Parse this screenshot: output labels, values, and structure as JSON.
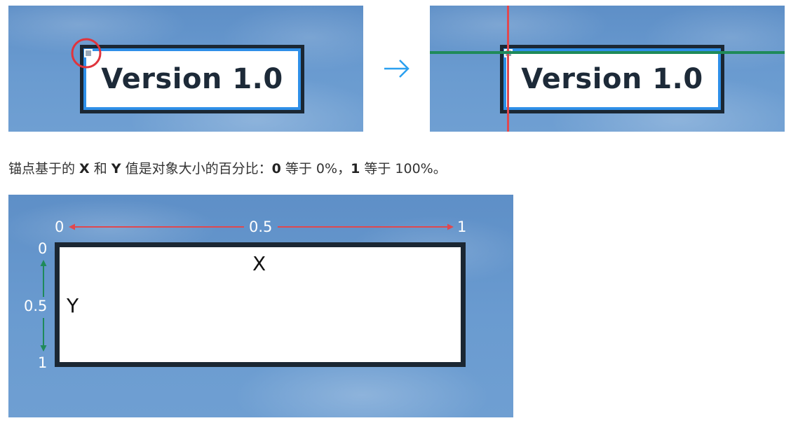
{
  "top_left": {
    "label": "Version 1.0"
  },
  "top_right": {
    "label": "Version 1.0"
  },
  "caption": {
    "part1": "锚点基于的 ",
    "x": "X",
    "part2": " 和 ",
    "y": "Y",
    "part3": " 值是对象大小的百分比：",
    "zero": "0",
    "part4": " 等于 0%，",
    "one": "1",
    "part5": " 等于 100%。"
  },
  "diagram": {
    "x_start": "0",
    "x_mid": "0.5",
    "x_end": "1",
    "y_start": "0",
    "y_mid": "0.5",
    "y_end": "1",
    "x_label": "X",
    "y_label": "Y"
  },
  "colors": {
    "red_axis": "#e0484f",
    "green_axis": "#1f8a5a",
    "border": "#1b2733",
    "accent_blue": "#2e8fe8",
    "arrow_blue": "#2aa0f0"
  }
}
